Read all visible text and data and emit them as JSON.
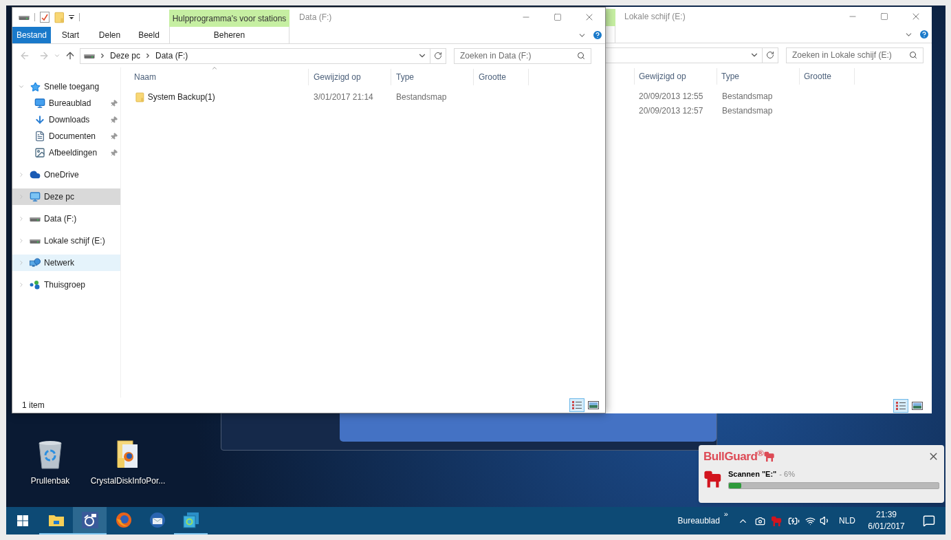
{
  "front_window": {
    "title": "Data (F:)",
    "context_tab_group": "Hulpprogramma's voor stations",
    "ribbon_tabs": [
      {
        "label": "Bestand",
        "kind": "file"
      },
      {
        "label": "Start",
        "kind": "tab"
      },
      {
        "label": "Delen",
        "kind": "tab"
      },
      {
        "label": "Beeld",
        "kind": "tab"
      },
      {
        "label": "Beheren",
        "kind": "context"
      }
    ],
    "address": [
      "Deze pc",
      "Data (F:)"
    ],
    "search": {
      "placeholder": "Zoeken in Data (F:)"
    },
    "nav": [
      {
        "label": "Snelle toegang",
        "kind": "star",
        "expanded": true,
        "selected": false,
        "hovered": false,
        "children": [
          {
            "label": "Bureaublad",
            "kind": "desktop",
            "pinned": true,
            "selected": false
          },
          {
            "label": "Downloads",
            "kind": "download",
            "pinned": true,
            "selected": false
          },
          {
            "label": "Documenten",
            "kind": "document",
            "pinned": true,
            "selected": false
          },
          {
            "label": "Afbeeldingen",
            "kind": "pictures",
            "pinned": true,
            "selected": false
          }
        ]
      },
      {
        "label": "OneDrive",
        "kind": "cloud",
        "expanded": false,
        "selected": false,
        "hovered": false
      },
      {
        "label": "Deze pc",
        "kind": "pc",
        "expanded": false,
        "selected": true,
        "hovered": false
      },
      {
        "label": "Data (F:)",
        "kind": "drive",
        "expanded": false,
        "selected": false,
        "hovered": false
      },
      {
        "label": "Lokale schijf (E:)",
        "kind": "drive",
        "expanded": false,
        "selected": false,
        "hovered": false
      },
      {
        "label": "Netwerk",
        "kind": "network",
        "expanded": false,
        "selected": false,
        "hovered": true
      },
      {
        "label": "Thuisgroep",
        "kind": "homegroup",
        "expanded": false,
        "selected": false,
        "hovered": false
      }
    ],
    "columns": [
      {
        "label": "Naam",
        "sorted": true
      },
      {
        "label": "Gewijzigd op",
        "sorted": false
      },
      {
        "label": "Type",
        "sorted": false
      },
      {
        "label": "Grootte",
        "sorted": false
      }
    ],
    "rows": [
      {
        "name": "System Backup(1)",
        "modified": "3/01/2017 21:14",
        "type": "Bestandsmap"
      }
    ],
    "status": "1 item",
    "views": [
      {
        "kind": "details",
        "selected": true
      },
      {
        "kind": "large",
        "selected": false
      }
    ]
  },
  "back_window": {
    "title": "Lokale schijf (E:)",
    "search": {
      "placeholder": "Zoeken in Lokale schijf (E:)"
    },
    "columns": [
      "Gewijzigd op",
      "Type",
      "Grootte"
    ],
    "rows": [
      {
        "modified": "20/09/2013 12:55",
        "type": "Bestandsmap"
      },
      {
        "modified": "20/09/2013 12:57",
        "type": "Bestandsmap"
      }
    ],
    "views": [
      {
        "kind": "details",
        "selected": true
      },
      {
        "kind": "large",
        "selected": false
      }
    ]
  },
  "desktop_icons": [
    {
      "label": "Prullenbak",
      "kind": "recycle-bin"
    },
    {
      "label": "CrystalDiskInfoPor...",
      "kind": "folder"
    }
  ],
  "notification": {
    "brand": "BullGuard$^{®}$",
    "message": "Scannen \"E:\"",
    "percent": "- 6%",
    "level": 0.06
  },
  "taskbar": {
    "apps": [
      {
        "kind": "explorer",
        "running": true,
        "selected": false
      },
      {
        "kind": "sync",
        "running": true,
        "selected": true
      },
      {
        "kind": "firefox",
        "running": false,
        "selected": false
      },
      {
        "kind": "thunderbird",
        "running": false,
        "selected": false
      },
      {
        "kind": "backup",
        "running": true,
        "selected": false
      }
    ],
    "toolbar": "Bureaublad",
    "toolbar_more": "»",
    "language": "NLD",
    "time": "21:39",
    "date": "6/01/2017"
  }
}
